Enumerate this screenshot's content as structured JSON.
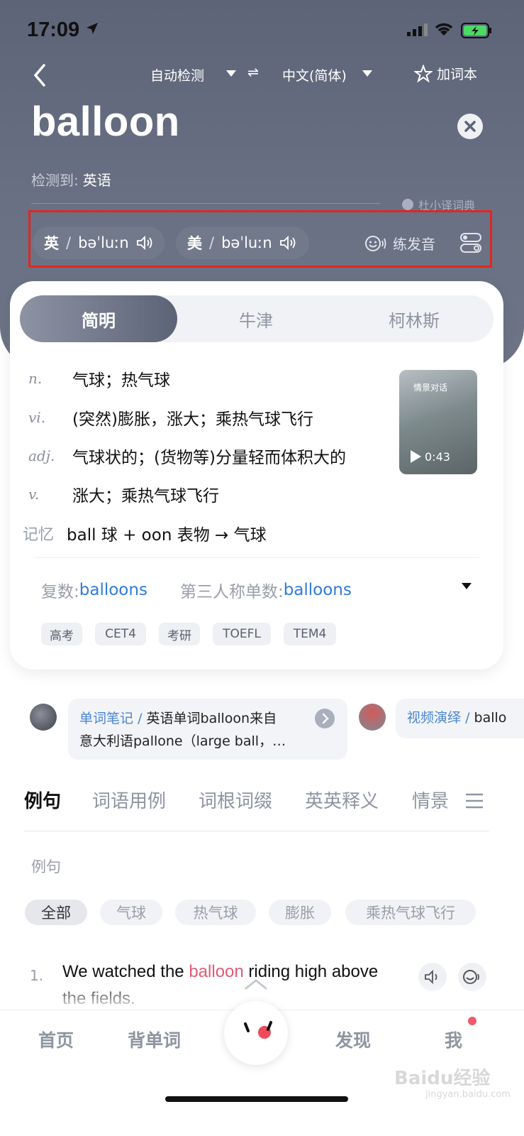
{
  "status": {
    "time": "17:09"
  },
  "header": {
    "source_lang": "自动检测",
    "swap_symbol": "⇌",
    "target_lang": "中文(简体)",
    "add_book": "加词本"
  },
  "word": "balloon",
  "detected": {
    "label": "检测到:",
    "value": "英语"
  },
  "dict_source": "杜小译词典",
  "pronunciations": [
    {
      "region": "英",
      "ipa": "bəˈluːn"
    },
    {
      "region": "美",
      "ipa": "bəˈluːn"
    }
  ],
  "practice_label": "练发音",
  "dict_tabs": [
    "简明",
    "牛津",
    "柯林斯"
  ],
  "definitions": [
    {
      "pos": "n.",
      "text": "气球；热气球"
    },
    {
      "pos": "vi.",
      "text": "(突然)膨胀，涨大；乘热气球飞行"
    },
    {
      "pos": "adj.",
      "text": "气球状的；(货物等)分量轻而体积大的"
    },
    {
      "pos": "v.",
      "text": "涨大；乘热气球飞行"
    }
  ],
  "memory": {
    "label": "记忆",
    "text": "ball 球 + oon 表物 → 气球"
  },
  "video_thumb": {
    "tag": "情景对话",
    "duration": "0:43"
  },
  "forms": [
    {
      "label": "复数:",
      "value": "balloons"
    },
    {
      "label": "第三人称单数:",
      "value": "balloons"
    }
  ],
  "exam_tags": [
    "高考",
    "CET4",
    "考研",
    "TOEFL",
    "TEM4"
  ],
  "note_card": {
    "tag": "单词笔记",
    "slash": "/",
    "line1": "英语单词balloon来自",
    "line2": "意大利语pallone（large ball，…"
  },
  "video_card": {
    "tag": "视频演绎",
    "slash": "/",
    "text": "ballo"
  },
  "section_tabs": [
    "例句",
    "词语用例",
    "词根词缀",
    "英英释义",
    "情景"
  ],
  "examples_label": "例句",
  "example_chips": [
    "全部",
    "气球",
    "热气球",
    "膨胀",
    "乘热气球飞行"
  ],
  "example": {
    "number": "1.",
    "before": "We watched the ",
    "highlight": "balloon",
    "after": " riding high above the fields."
  },
  "bottom_nav": [
    "首页",
    "背单词",
    "发现",
    "我"
  ],
  "watermark": {
    "main": "Baidu经验",
    "sub": "jingyan.baidu.com"
  },
  "colors": {
    "header_bg": "#5d6478",
    "accent_blue": "#2f7cd8",
    "highlight": "#e25b77",
    "annotation_red": "#e3261f"
  }
}
